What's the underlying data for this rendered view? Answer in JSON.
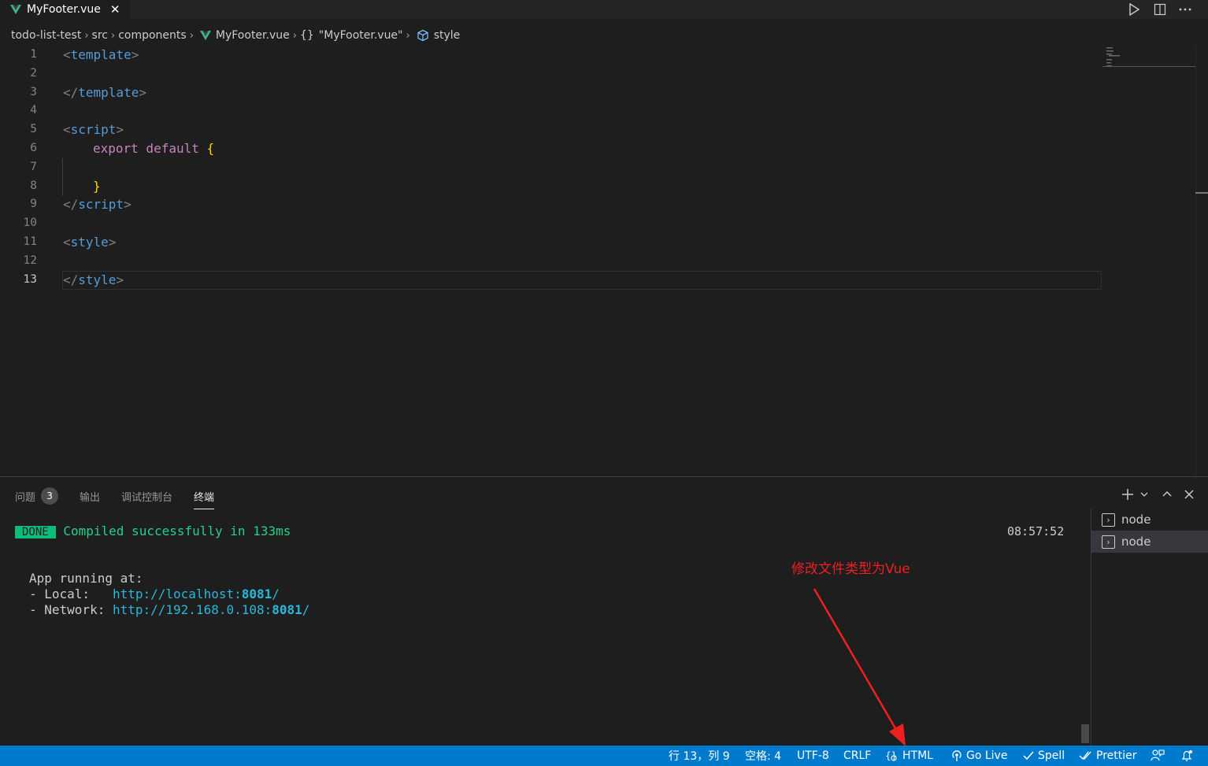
{
  "tab": {
    "filename": "MyFooter.vue",
    "close_glyph": "✕"
  },
  "breadcrumb": {
    "items": [
      "todo-list-test",
      "src",
      "components",
      "MyFooter.vue",
      "\"MyFooter.vue\"",
      "style"
    ],
    "object_glyph": "{}"
  },
  "editor": {
    "line_numbers": [
      "1",
      "2",
      "3",
      "4",
      "5",
      "6",
      "7",
      "8",
      "9",
      "10",
      "11",
      "12",
      "13"
    ],
    "current_line": "13",
    "lines": {
      "l1_open": "<",
      "l1_name": "template",
      "l1_close": ">",
      "l3_open": "</",
      "l3_name": "template",
      "l3_close": ">",
      "l5_open": "<",
      "l5_name": "script",
      "l5_close": ">",
      "l6_kw": "export default",
      "l6_brace": "{",
      "l8_brace": "}",
      "l9_open": "</",
      "l9_name": "script",
      "l9_close": ">",
      "l11_open": "<",
      "l11_name": "style",
      "l11_close": ">",
      "l13_open": "</",
      "l13_name": "style",
      "l13_close": ">"
    }
  },
  "panel": {
    "tabs": [
      "问题",
      "输出",
      "调试控制台",
      "终端"
    ],
    "problems_count": "3",
    "active_tab": "终端"
  },
  "terminal": {
    "done_label": "DONE",
    "compiled": "Compiled successfully in 133ms",
    "time": "08:57:52",
    "app_running": "App running at:",
    "local_label": "- Local:   ",
    "local_url_prefix": "http://localhost:",
    "local_port": "8081",
    "local_url_suffix": "/",
    "network_label": "- Network: ",
    "network_url_prefix": "http://192.168.0.108:",
    "network_port": "8081",
    "network_url_suffix": "/",
    "sessions": [
      "node",
      "node"
    ]
  },
  "annotation": {
    "text": "修改文件类型为Vue",
    "color": "#ef2020"
  },
  "statusbar": {
    "position": "行 13，列 9",
    "indent": "空格: 4",
    "encoding": "UTF-8",
    "eol": "CRLF",
    "language": "HTML",
    "golive": "Go Live",
    "spell": "Spell",
    "prettier": "Prettier"
  },
  "colors": {
    "statusbar_bg": "#007acc",
    "editor_bg": "#1e1e1e",
    "tag_name": "#569cd6",
    "keyword": "#c586c0",
    "bracket": "#ffd700",
    "done_bg": "#0dbc79",
    "success_text": "#23d18b",
    "link": "#29b8db"
  }
}
